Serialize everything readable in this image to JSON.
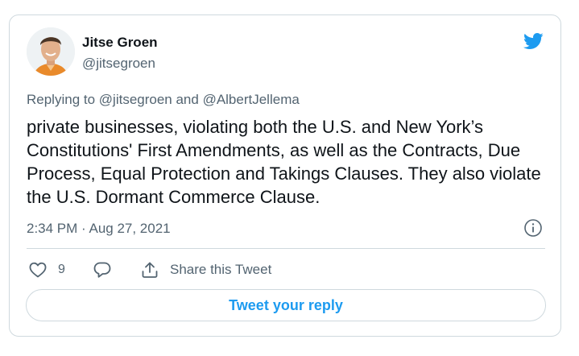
{
  "author": {
    "name": "Jitse Groen",
    "handle": "@jitsegroen"
  },
  "tweet": {
    "replying_prefix": "Replying to ",
    "replying_to_1": "@jitsegroen",
    "replying_conj": " and ",
    "replying_to_2": "@AlbertJellema",
    "text": "private businesses, violating both the U.S. and New York’s Constitutions' First Amendments, as well as the Contracts, Due Process, Equal Protection and Takings Clauses. They also violate the U.S. Dormant Commerce Clause.",
    "timestamp": "2:34 PM · Aug 27, 2021"
  },
  "actions": {
    "like_count": "9",
    "share_label": "Share this Tweet"
  },
  "reply_button_label": "Tweet your reply",
  "icons": {
    "brand": "twitter-bird-icon",
    "info": "info-icon",
    "like": "heart-icon",
    "reply": "speech-bubble-icon",
    "share": "share-icon"
  },
  "colors": {
    "accent": "#1d9bf0",
    "text": "#0f1419",
    "secondary": "#536471",
    "border": "#cfd9de"
  }
}
